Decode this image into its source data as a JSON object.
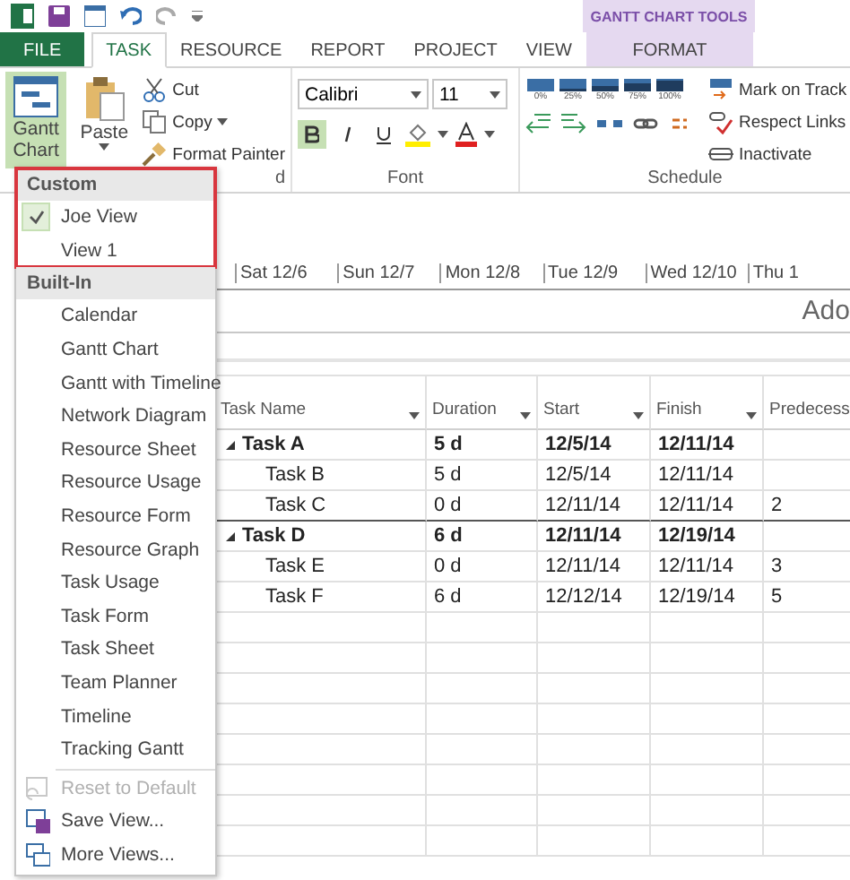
{
  "contextual_group": "GANTT CHART TOOLS",
  "ribbon_tabs": [
    {
      "label": "FILE",
      "kind": "file",
      "selected": false
    },
    {
      "label": "TASK",
      "kind": "normal",
      "selected": true
    },
    {
      "label": "RESOURCE",
      "kind": "normal",
      "selected": false
    },
    {
      "label": "REPORT",
      "kind": "normal",
      "selected": false
    },
    {
      "label": "PROJECT",
      "kind": "normal",
      "selected": false
    },
    {
      "label": "VIEW",
      "kind": "normal",
      "selected": false
    },
    {
      "label": "FORMAT",
      "kind": "contextual",
      "selected": false
    }
  ],
  "ribbon": {
    "gantt_button": {
      "label": "Gantt Chart",
      "selected": true
    },
    "paste": "Paste",
    "clipboard": [
      "Cut",
      "Copy",
      "Format Painter"
    ],
    "font": {
      "name": "Calibri",
      "size": "11",
      "bold": true
    },
    "percent": [
      "0%",
      "25%",
      "50%",
      "75%",
      "100%"
    ],
    "schedule_actions": [
      "Mark on Track",
      "Respect Links",
      "Inactivate"
    ],
    "group_labels": [
      "d",
      "Font",
      "Schedule"
    ]
  },
  "timeline": {
    "dates": [
      "Sat 12/6",
      "Sun 12/7",
      "Mon 12/8",
      "Tue 12/9",
      "Wed 12/10",
      "Thu 1"
    ],
    "hint": "Ado"
  },
  "table": {
    "columns": [
      "Task Name",
      "Duration",
      "Start",
      "Finish",
      "Predecess"
    ],
    "rows": [
      {
        "name": "Task A",
        "duration": "5 d",
        "start": "12/5/14",
        "finish": "12/11/14",
        "summary": true
      },
      {
        "name": "Task B",
        "duration": "5 d",
        "start": "12/5/14",
        "finish": "12/11/14",
        "summary": false
      },
      {
        "name": "Task C",
        "duration": "0 d",
        "start": "12/11/14",
        "finish": "12/11/14",
        "predecessors": "2",
        "summary": false
      },
      {
        "name": "Task D",
        "duration": "6 d",
        "start": "12/11/14",
        "finish": "12/19/14",
        "summary": true
      },
      {
        "name": "Task E",
        "duration": "0 d",
        "start": "12/11/14",
        "finish": "12/11/14",
        "predecessors": "3",
        "summary": false
      },
      {
        "name": "Task F",
        "duration": "6 d",
        "start": "12/12/14",
        "finish": "12/19/14",
        "predecessors": "5",
        "summary": false
      }
    ]
  },
  "menu": {
    "sections": [
      {
        "title": "Custom",
        "highlighted": true,
        "items": [
          {
            "label": "Joe View",
            "checked": true
          },
          {
            "label": "View 1",
            "checked": false
          }
        ]
      },
      {
        "title": "Built-In",
        "highlighted": false,
        "items": [
          {
            "label": "Calendar",
            "checked": false
          },
          {
            "label": "Gantt Chart",
            "checked": false
          },
          {
            "label": "Gantt with Timeline",
            "checked": false
          },
          {
            "label": "Network Diagram",
            "checked": false
          },
          {
            "label": "Resource Sheet",
            "checked": false
          },
          {
            "label": "Resource Usage",
            "checked": false
          },
          {
            "label": "Resource Form",
            "checked": false
          },
          {
            "label": "Resource Graph",
            "checked": false
          },
          {
            "label": "Task Usage",
            "checked": false
          },
          {
            "label": "Task Form",
            "checked": false
          },
          {
            "label": "Task Sheet",
            "checked": false
          },
          {
            "label": "Team Planner",
            "checked": false
          },
          {
            "label": "Timeline",
            "checked": false
          },
          {
            "label": "Tracking Gantt",
            "checked": false
          }
        ]
      }
    ],
    "actions": [
      {
        "label": "Reset to Default",
        "kind": "reset",
        "disabled": true
      },
      {
        "label": "Save View...",
        "kind": "save",
        "disabled": false
      },
      {
        "label": "More Views...",
        "kind": "more",
        "disabled": false
      }
    ]
  }
}
